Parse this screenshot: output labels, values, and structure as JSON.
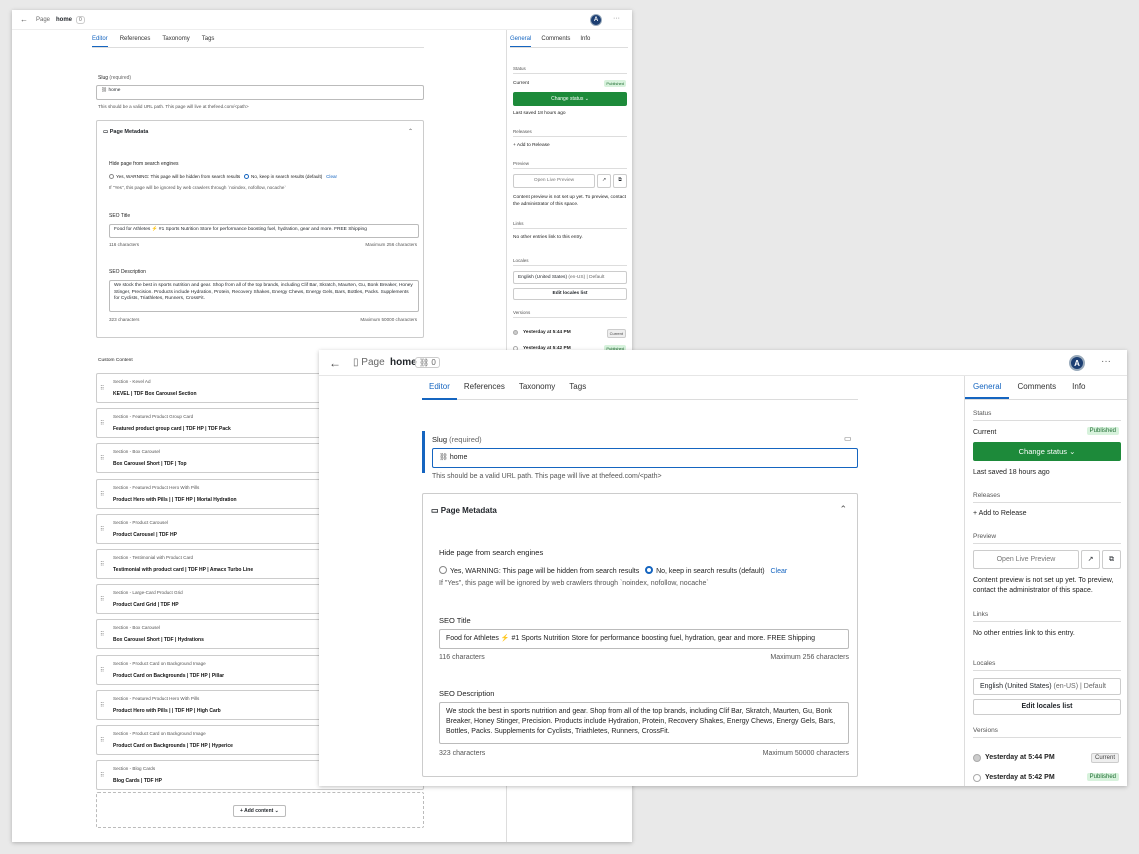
{
  "header": {
    "breadcrumb": "Page",
    "title": "home",
    "ref_count": "0",
    "avatar": "A",
    "more": "···"
  },
  "tabs": [
    "Editor",
    "References",
    "Taxonomy",
    "Tags"
  ],
  "side_tabs": [
    "General",
    "Comments",
    "Info"
  ],
  "slug": {
    "label": "Slug",
    "required": "(required)",
    "value": "home",
    "hint": "This should be a valid URL path. This page will live at thefeed.com/<path>"
  },
  "metadata": {
    "title": "Page Metadata",
    "hide_label": "Hide page from search engines",
    "option_yes": "Yes, WARNING: This page will be hidden from search results",
    "option_no": "No, keep in search results (default)",
    "clear": "Clear",
    "hide_hint": "If \"Yes\", this page will be ignored by web crawlers through `noindex, nofollow, nocache`",
    "seo_title_label": "SEO Title",
    "seo_title_value": "Food for Athletes ⚡ #1 Sports Nutrition Store for performance boosting fuel, hydration, gear and more. FREE Shipping",
    "seo_title_count": "116 characters",
    "seo_title_max": "Maximum 256 characters",
    "seo_desc_label": "SEO Description",
    "seo_desc_value": "We stock the best in sports nutrition and gear. Shop from all of the top brands, including Clif Bar, Skratch, Maurten, Gu, Bonk Breaker, Honey Stinger, Precision. Products include Hydration, Protein, Recovery Shakes, Energy Chews, Energy Gels, Bars, Bottles, Packs. Supplements for Cyclists, Triathletes, Runners, CrossFit.",
    "seo_desc_count": "323 characters",
    "seo_desc_max": "Maximum 50000 characters"
  },
  "custom_content": {
    "label": "Custom Content",
    "items": [
      {
        "type": "Section - Kevel Ad",
        "name": "KEVEL | TDF Box Carousel Section"
      },
      {
        "type": "Section - Featured Product Group Card",
        "name": "Featured product group card | TDF HP | TDF Pack"
      },
      {
        "type": "Section - Box Carousel",
        "name": "Box Carousel Short | TDF | Top"
      },
      {
        "type": "Section - Featured Product Hero With Pills",
        "name": "Product Hero with Pills | | TDF HP | Mortal Hydration"
      },
      {
        "type": "Section - Product Carousel",
        "name": "Product Carousel | TDF HP"
      },
      {
        "type": "Section - Testimonial with Product Card",
        "name": "Testimonial with product card | TDF HP | Amacx Turbo Line"
      },
      {
        "type": "Section - Large-Card Product Grid",
        "name": "Product Card Grid | TDF HP"
      },
      {
        "type": "Section - Box Carousel",
        "name": "Box Carousel Short | TDF | Hydrations"
      },
      {
        "type": "Section - Product Card on Background Image",
        "name": "Product Card on Backgrounds | TDF HP | Pillar"
      },
      {
        "type": "Section - Featured Product Hero With Pills",
        "name": "Product Hero with Pills | | TDF HP | High Carb"
      },
      {
        "type": "Section - Product Card on Background Image",
        "name": "Product Card on Backgrounds | TDF HP | Hyperice"
      },
      {
        "type": "Section - Blog Cards",
        "name": "Blog Cards | TDF HP"
      }
    ],
    "add_button": "Add content"
  },
  "sidebar": {
    "status_label": "Status",
    "current_label": "Current",
    "published_badge": "Published",
    "change_status": "Change status",
    "last_saved": "Last saved 18 hours ago",
    "releases_label": "Releases",
    "add_to_release": "Add to Release",
    "preview_label": "Preview",
    "open_live_preview": "Open Live Preview",
    "preview_note": "Content preview is not set up yet. To preview, contact the administrator of this space.",
    "links_label": "Links",
    "links_note": "No other entries link to this entry.",
    "locales_label": "Locales",
    "locale_value": "English (United States)",
    "locale_code": "(en-US)",
    "locale_default": "| Default",
    "edit_locales": "Edit locales list",
    "versions_label": "Versions",
    "versions": [
      {
        "time": "Yesterday at 5:44 PM",
        "badge": "Current"
      },
      {
        "time": "Yesterday at 5:42 PM",
        "badge": "Published"
      }
    ]
  },
  "colors": {
    "accent": "#1565c0",
    "primary_green": "#1d8a3a",
    "published_bg": "#d7f2dc"
  }
}
